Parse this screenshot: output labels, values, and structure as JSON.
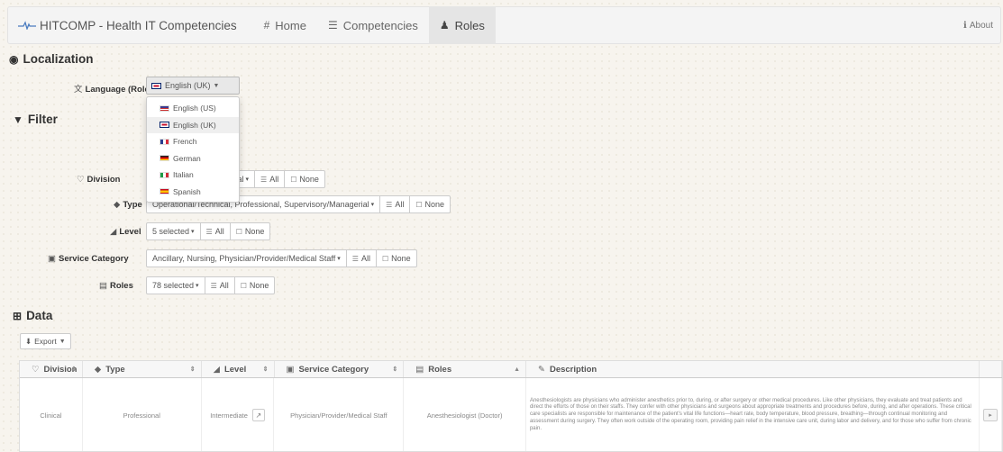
{
  "navbar": {
    "brand": "HITCOMP - Health IT Competencies",
    "items": [
      {
        "label": "Home",
        "icon": "home-icon"
      },
      {
        "label": "Competencies",
        "icon": "list-icon"
      },
      {
        "label": "Roles",
        "icon": "user-icon",
        "active": true
      }
    ],
    "about": "About"
  },
  "localization": {
    "title": "Localization",
    "language_label": "Language (Roles)",
    "language_value": "English (UK)",
    "languages": [
      {
        "label": "English (US)",
        "flag": "us"
      },
      {
        "label": "English (UK)",
        "flag": "uk",
        "active": true
      },
      {
        "label": "French",
        "flag": "fr"
      },
      {
        "label": "German",
        "flag": "de"
      },
      {
        "label": "Italian",
        "flag": "it"
      },
      {
        "label": "Spanish",
        "flag": "es"
      }
    ]
  },
  "filter": {
    "title": "Filter",
    "all_label": "All",
    "none_label": "None",
    "division": {
      "label": "Division",
      "value": "ical"
    },
    "type": {
      "label": "Type",
      "value": "Operational/Technical, Professional, Supervisory/Managerial"
    },
    "level": {
      "label": "Level",
      "value": "5 selected"
    },
    "service_category": {
      "label": "Service Category",
      "value": "Ancillary, Nursing, Physician/Provider/Medical Staff"
    },
    "roles": {
      "label": "Roles",
      "value": "78 selected"
    }
  },
  "data": {
    "title": "Data",
    "export_label": "Export",
    "columns": [
      "Division",
      "Type",
      "Level",
      "Service Category",
      "Roles",
      "Description"
    ],
    "rows": [
      {
        "division": "Clinical",
        "type": "Professional",
        "level": "Intermediate",
        "service_category": "Physician/Provider/Medical Staff",
        "role": "Anesthesiologist (Doctor)",
        "description": "Anesthesiologists are physicians who administer anesthetics prior to, during, or after surgery or other medical procedures. Like other physicians, they evaluate and treat patients and direct the efforts of those on their staffs. They confer with other physicians and surgeons about appropriate treatments and procedures before, during, and after operations. These critical care specialists are responsible for maintenance of the patient's vital life functions—heart rate, body temperature, blood pressure, breathing—through continual monitoring and assessment during surgery. They often work outside of the operating room, providing pain relief in the intensive care unit, during labor and delivery, and for those who suffer from chronic pain."
      }
    ]
  },
  "colors": {
    "roles_icon": "#d0415a",
    "active_nav": "#e5e5e5"
  }
}
